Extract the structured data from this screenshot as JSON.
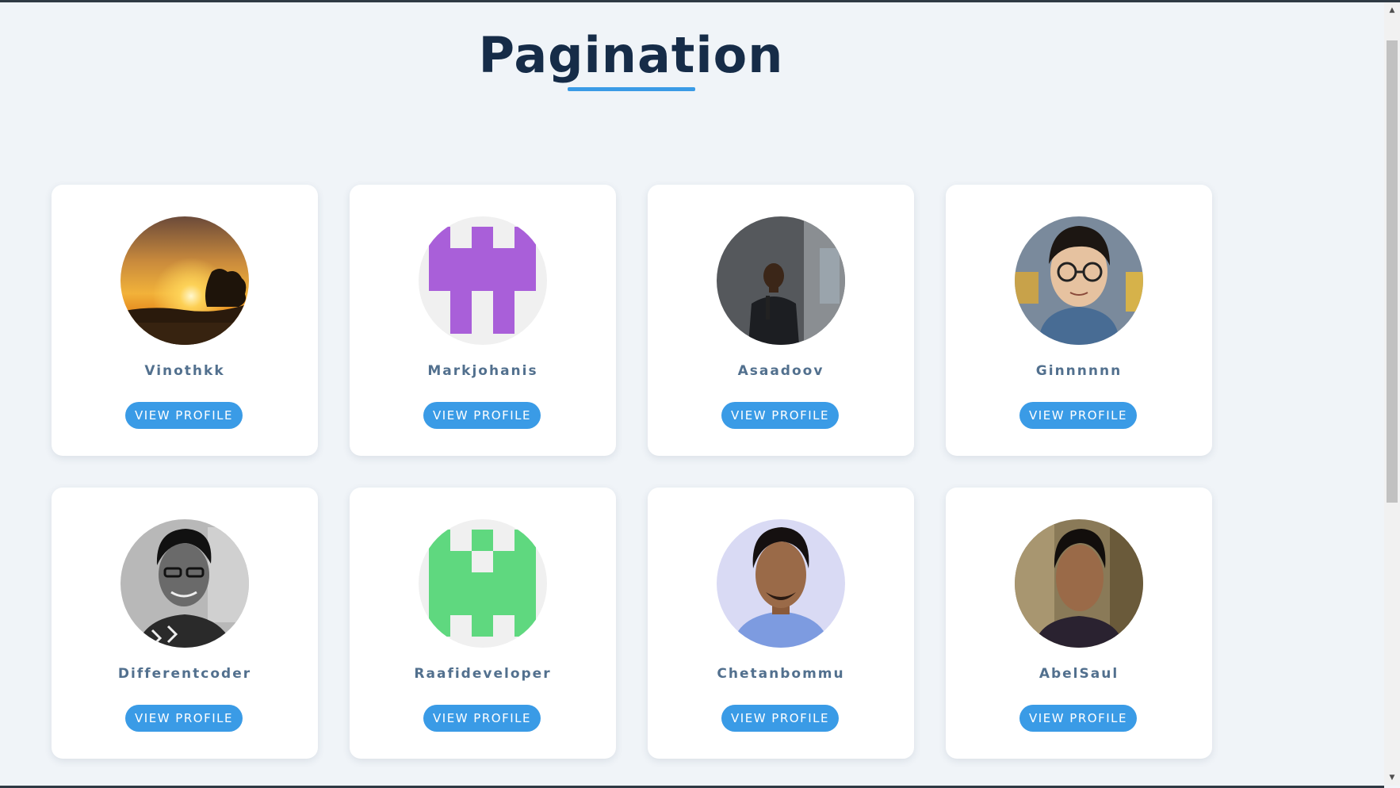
{
  "page": {
    "title": "Pagination"
  },
  "profiles": [
    {
      "name": "Vinothkk",
      "button": "VIEW PROFILE",
      "avatar": "sunset-photo-avatar"
    },
    {
      "name": "Markjohanis",
      "button": "VIEW PROFILE",
      "avatar": "purple-identicon-avatar",
      "color": "#a95fd9"
    },
    {
      "name": "Asaadoov",
      "button": "VIEW PROFILE",
      "avatar": "speaker-photo-avatar"
    },
    {
      "name": "Ginnnnnn",
      "button": "VIEW PROFILE",
      "avatar": "glasses-person-photo-avatar"
    },
    {
      "name": "Differentcoder",
      "button": "VIEW PROFILE",
      "avatar": "bw-portrait-photo-avatar"
    },
    {
      "name": "Raafideveloper",
      "button": "VIEW PROFILE",
      "avatar": "green-identicon-avatar",
      "color": "#5fd87f"
    },
    {
      "name": "Chetanbommu",
      "button": "VIEW PROFILE",
      "avatar": "person-photo-avatar"
    },
    {
      "name": "AbelSaul",
      "button": "VIEW PROFILE",
      "avatar": "outdoor-portrait-photo-avatar"
    }
  ],
  "colors": {
    "background": "#f0f4f8",
    "title": "#162c48",
    "accent": "#3a9be6",
    "name_text": "#52708e",
    "card": "#ffffff"
  },
  "scrollbar": {
    "up_icon": "chevron-up-icon",
    "down_icon": "chevron-down-icon"
  }
}
